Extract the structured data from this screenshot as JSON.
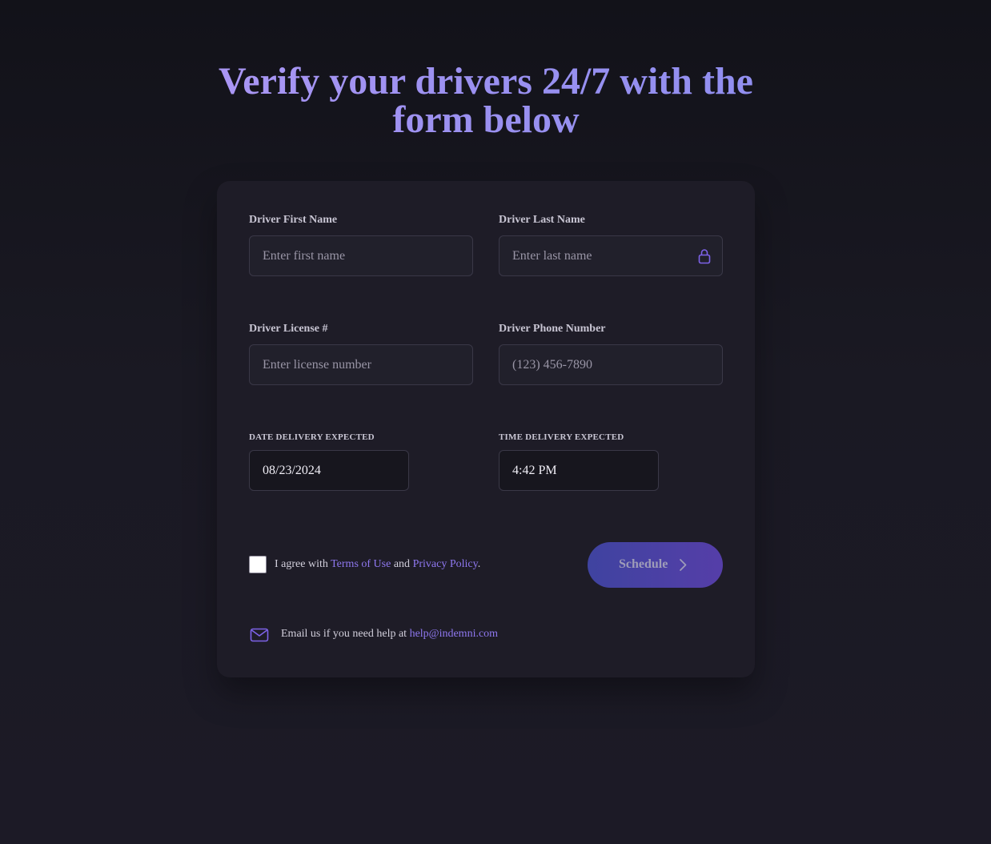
{
  "heading": {
    "line1": "Verify your drivers 24/7 with the",
    "line2": "form below"
  },
  "form": {
    "first_name": {
      "label": "Driver First Name",
      "placeholder": "Enter first name",
      "value": ""
    },
    "last_name": {
      "label": "Driver Last Name",
      "placeholder": "Enter last name",
      "value": "",
      "icon": "lock-icon"
    },
    "license": {
      "label": "Driver License #",
      "placeholder": "Enter license number",
      "value": ""
    },
    "phone": {
      "label": "Driver Phone Number",
      "placeholder": "(123) 456-7890",
      "value": ""
    },
    "date": {
      "label": "DATE DELIVERY EXPECTED",
      "value": "08/23/2024"
    },
    "time": {
      "label": "TIME DELIVERY EXPECTED",
      "value": "4:42 PM"
    },
    "agree": {
      "prefix": "I agree with",
      "terms_link": "Terms of Use",
      "middle": "and",
      "privacy_link": "Privacy Policy",
      "suffix": ".",
      "checked": false
    },
    "submit": {
      "label": "Schedule",
      "icon": "chevron-right-icon"
    },
    "help": {
      "icon": "mail-icon",
      "text": "Email us if you need help at",
      "email": "help@indemni.com"
    }
  },
  "colors": {
    "accent": "#8f78f0",
    "heading_gradient_start": "#b79cf7",
    "heading_gradient_end": "#8a8ef0",
    "card_background": "#1e1c27",
    "button_gradient_start": "#3f43a0",
    "button_gradient_end": "#553ea8"
  }
}
